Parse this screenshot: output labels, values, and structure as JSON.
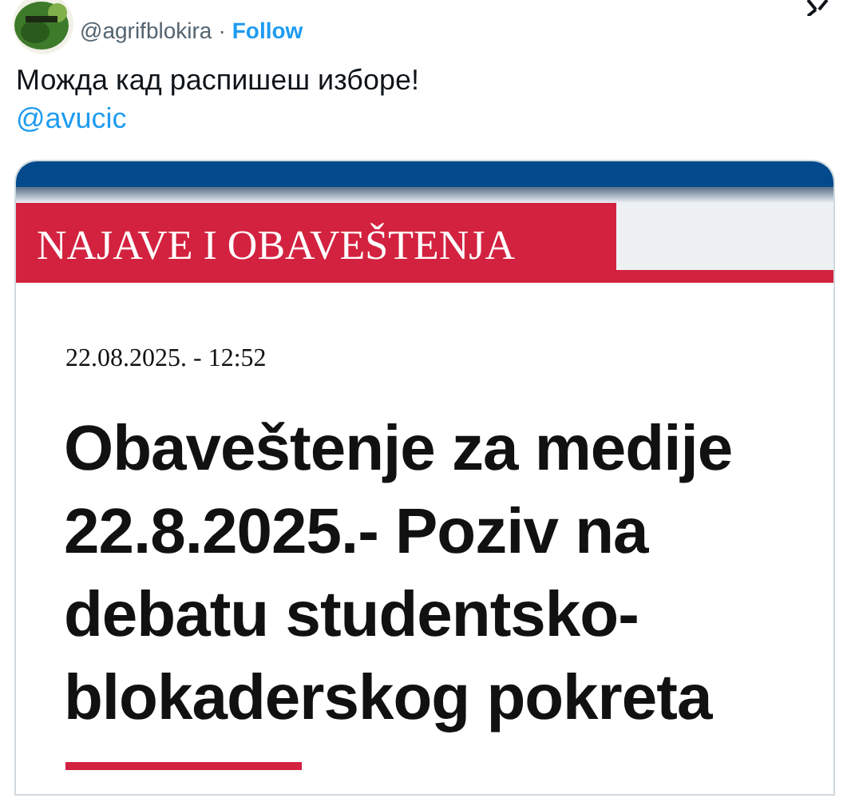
{
  "tweet": {
    "handle": "@agrifblokira",
    "separator": "·",
    "follow": "Follow",
    "text": "Можда кад распишеш изборе!",
    "mention": "@avucic"
  },
  "card": {
    "kind": "picture-card",
    "banner": "NAJAVE I OBAVEŠTENJA",
    "date": "22.08.2025. - 12:52",
    "headline": "Obaveštenje za medije 22.8.2025.- Poziv na debatu studentsko-blokaderskog pokreta"
  }
}
